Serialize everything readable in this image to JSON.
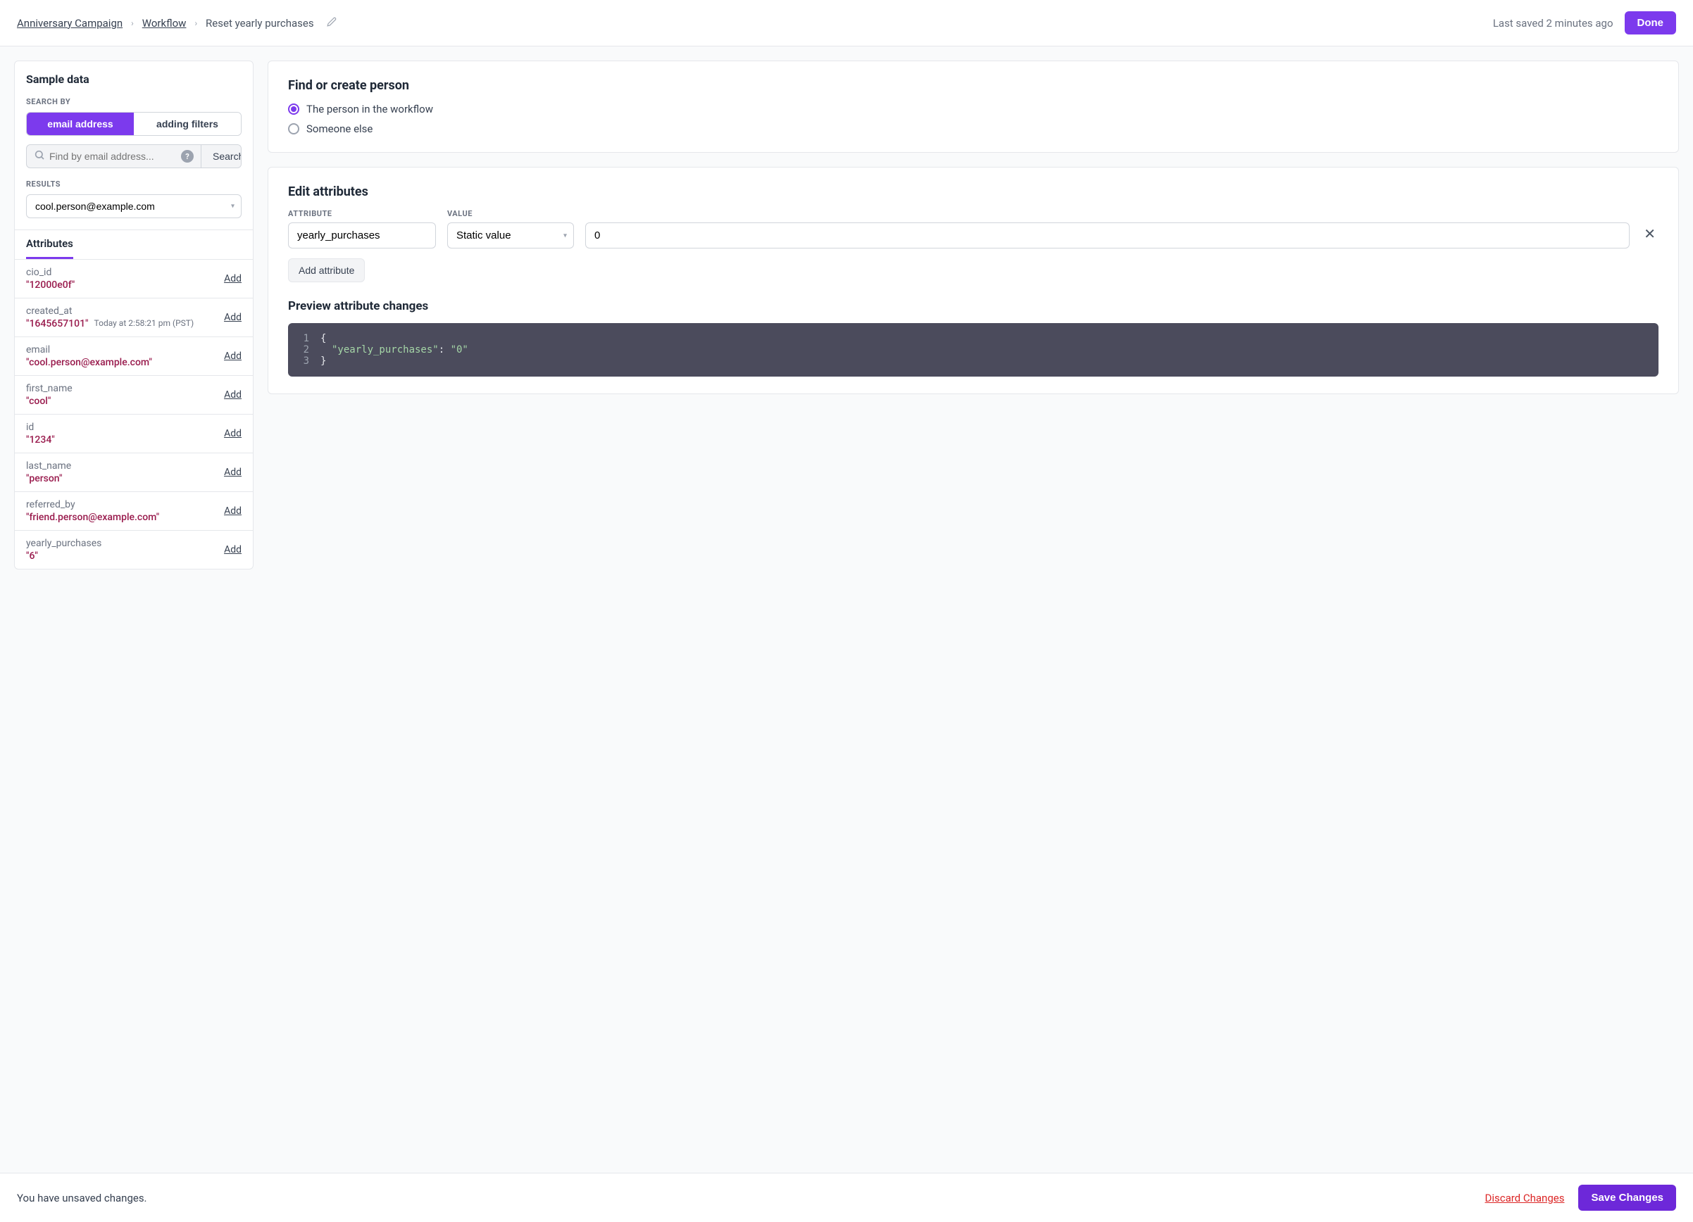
{
  "breadcrumb": {
    "campaign": "Anniversary Campaign",
    "workflow": "Workflow",
    "current": "Reset yearly purchases"
  },
  "header": {
    "last_saved": "Last saved 2 minutes ago",
    "done": "Done"
  },
  "sidebar": {
    "title": "Sample data",
    "search_by_label": "SEARCH BY",
    "toggle_email": "email address",
    "toggle_filters": "adding filters",
    "search_placeholder": "Find by email address...",
    "search_button": "Search",
    "results_label": "RESULTS",
    "selected_result": "cool.person@example.com",
    "tab": "Attributes",
    "attributes": [
      {
        "key": "cio_id",
        "value": "\"12000e0f\"",
        "add": "Add"
      },
      {
        "key": "created_at",
        "value": "\"1645657101\"",
        "note": "Today at 2:58:21 pm (PST)",
        "add": "Add"
      },
      {
        "key": "email",
        "value": "\"cool.person@example.com\"",
        "add": "Add"
      },
      {
        "key": "first_name",
        "value": "\"cool\"",
        "add": "Add"
      },
      {
        "key": "id",
        "value": "\"1234\"",
        "add": "Add"
      },
      {
        "key": "last_name",
        "value": "\"person\"",
        "add": "Add"
      },
      {
        "key": "referred_by",
        "value": "\"friend.person@example.com\"",
        "add": "Add"
      },
      {
        "key": "yearly_purchases",
        "value": "\"6\"",
        "add": "Add"
      }
    ]
  },
  "find_person": {
    "title": "Find or create person",
    "option_workflow": "The person in the workflow",
    "option_else": "Someone else"
  },
  "edit": {
    "title": "Edit attributes",
    "attr_label": "ATTRIBUTE",
    "value_label": "VALUE",
    "attribute_name": "yearly_purchases",
    "value_type": "Static value",
    "value": "0",
    "add_button": "Add attribute",
    "preview_title": "Preview attribute changes",
    "preview": {
      "line1": "{",
      "line2_key": "\"yearly_purchases\"",
      "line2_colon": ": ",
      "line2_val": "\"0\"",
      "line3": "}"
    }
  },
  "footer": {
    "message": "You have unsaved changes.",
    "discard": "Discard Changes",
    "save": "Save Changes"
  }
}
